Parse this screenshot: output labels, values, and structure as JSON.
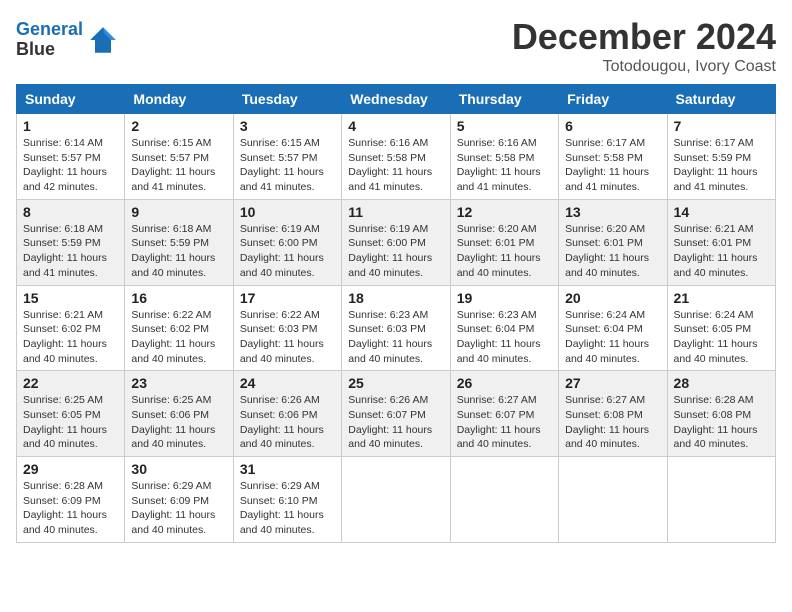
{
  "header": {
    "logo_line1": "General",
    "logo_line2": "Blue",
    "month_title": "December 2024",
    "location": "Totodougou, Ivory Coast"
  },
  "weekdays": [
    "Sunday",
    "Monday",
    "Tuesday",
    "Wednesday",
    "Thursday",
    "Friday",
    "Saturday"
  ],
  "weeks": [
    [
      {
        "day": "1",
        "sunrise": "6:14 AM",
        "sunset": "5:57 PM",
        "daylight": "11 hours and 42 minutes."
      },
      {
        "day": "2",
        "sunrise": "6:15 AM",
        "sunset": "5:57 PM",
        "daylight": "11 hours and 41 minutes."
      },
      {
        "day": "3",
        "sunrise": "6:15 AM",
        "sunset": "5:57 PM",
        "daylight": "11 hours and 41 minutes."
      },
      {
        "day": "4",
        "sunrise": "6:16 AM",
        "sunset": "5:58 PM",
        "daylight": "11 hours and 41 minutes."
      },
      {
        "day": "5",
        "sunrise": "6:16 AM",
        "sunset": "5:58 PM",
        "daylight": "11 hours and 41 minutes."
      },
      {
        "day": "6",
        "sunrise": "6:17 AM",
        "sunset": "5:58 PM",
        "daylight": "11 hours and 41 minutes."
      },
      {
        "day": "7",
        "sunrise": "6:17 AM",
        "sunset": "5:59 PM",
        "daylight": "11 hours and 41 minutes."
      }
    ],
    [
      {
        "day": "8",
        "sunrise": "6:18 AM",
        "sunset": "5:59 PM",
        "daylight": "11 hours and 41 minutes."
      },
      {
        "day": "9",
        "sunrise": "6:18 AM",
        "sunset": "5:59 PM",
        "daylight": "11 hours and 40 minutes."
      },
      {
        "day": "10",
        "sunrise": "6:19 AM",
        "sunset": "6:00 PM",
        "daylight": "11 hours and 40 minutes."
      },
      {
        "day": "11",
        "sunrise": "6:19 AM",
        "sunset": "6:00 PM",
        "daylight": "11 hours and 40 minutes."
      },
      {
        "day": "12",
        "sunrise": "6:20 AM",
        "sunset": "6:01 PM",
        "daylight": "11 hours and 40 minutes."
      },
      {
        "day": "13",
        "sunrise": "6:20 AM",
        "sunset": "6:01 PM",
        "daylight": "11 hours and 40 minutes."
      },
      {
        "day": "14",
        "sunrise": "6:21 AM",
        "sunset": "6:01 PM",
        "daylight": "11 hours and 40 minutes."
      }
    ],
    [
      {
        "day": "15",
        "sunrise": "6:21 AM",
        "sunset": "6:02 PM",
        "daylight": "11 hours and 40 minutes."
      },
      {
        "day": "16",
        "sunrise": "6:22 AM",
        "sunset": "6:02 PM",
        "daylight": "11 hours and 40 minutes."
      },
      {
        "day": "17",
        "sunrise": "6:22 AM",
        "sunset": "6:03 PM",
        "daylight": "11 hours and 40 minutes."
      },
      {
        "day": "18",
        "sunrise": "6:23 AM",
        "sunset": "6:03 PM",
        "daylight": "11 hours and 40 minutes."
      },
      {
        "day": "19",
        "sunrise": "6:23 AM",
        "sunset": "6:04 PM",
        "daylight": "11 hours and 40 minutes."
      },
      {
        "day": "20",
        "sunrise": "6:24 AM",
        "sunset": "6:04 PM",
        "daylight": "11 hours and 40 minutes."
      },
      {
        "day": "21",
        "sunrise": "6:24 AM",
        "sunset": "6:05 PM",
        "daylight": "11 hours and 40 minutes."
      }
    ],
    [
      {
        "day": "22",
        "sunrise": "6:25 AM",
        "sunset": "6:05 PM",
        "daylight": "11 hours and 40 minutes."
      },
      {
        "day": "23",
        "sunrise": "6:25 AM",
        "sunset": "6:06 PM",
        "daylight": "11 hours and 40 minutes."
      },
      {
        "day": "24",
        "sunrise": "6:26 AM",
        "sunset": "6:06 PM",
        "daylight": "11 hours and 40 minutes."
      },
      {
        "day": "25",
        "sunrise": "6:26 AM",
        "sunset": "6:07 PM",
        "daylight": "11 hours and 40 minutes."
      },
      {
        "day": "26",
        "sunrise": "6:27 AM",
        "sunset": "6:07 PM",
        "daylight": "11 hours and 40 minutes."
      },
      {
        "day": "27",
        "sunrise": "6:27 AM",
        "sunset": "6:08 PM",
        "daylight": "11 hours and 40 minutes."
      },
      {
        "day": "28",
        "sunrise": "6:28 AM",
        "sunset": "6:08 PM",
        "daylight": "11 hours and 40 minutes."
      }
    ],
    [
      {
        "day": "29",
        "sunrise": "6:28 AM",
        "sunset": "6:09 PM",
        "daylight": "11 hours and 40 minutes."
      },
      {
        "day": "30",
        "sunrise": "6:29 AM",
        "sunset": "6:09 PM",
        "daylight": "11 hours and 40 minutes."
      },
      {
        "day": "31",
        "sunrise": "6:29 AM",
        "sunset": "6:10 PM",
        "daylight": "11 hours and 40 minutes."
      },
      null,
      null,
      null,
      null
    ]
  ]
}
